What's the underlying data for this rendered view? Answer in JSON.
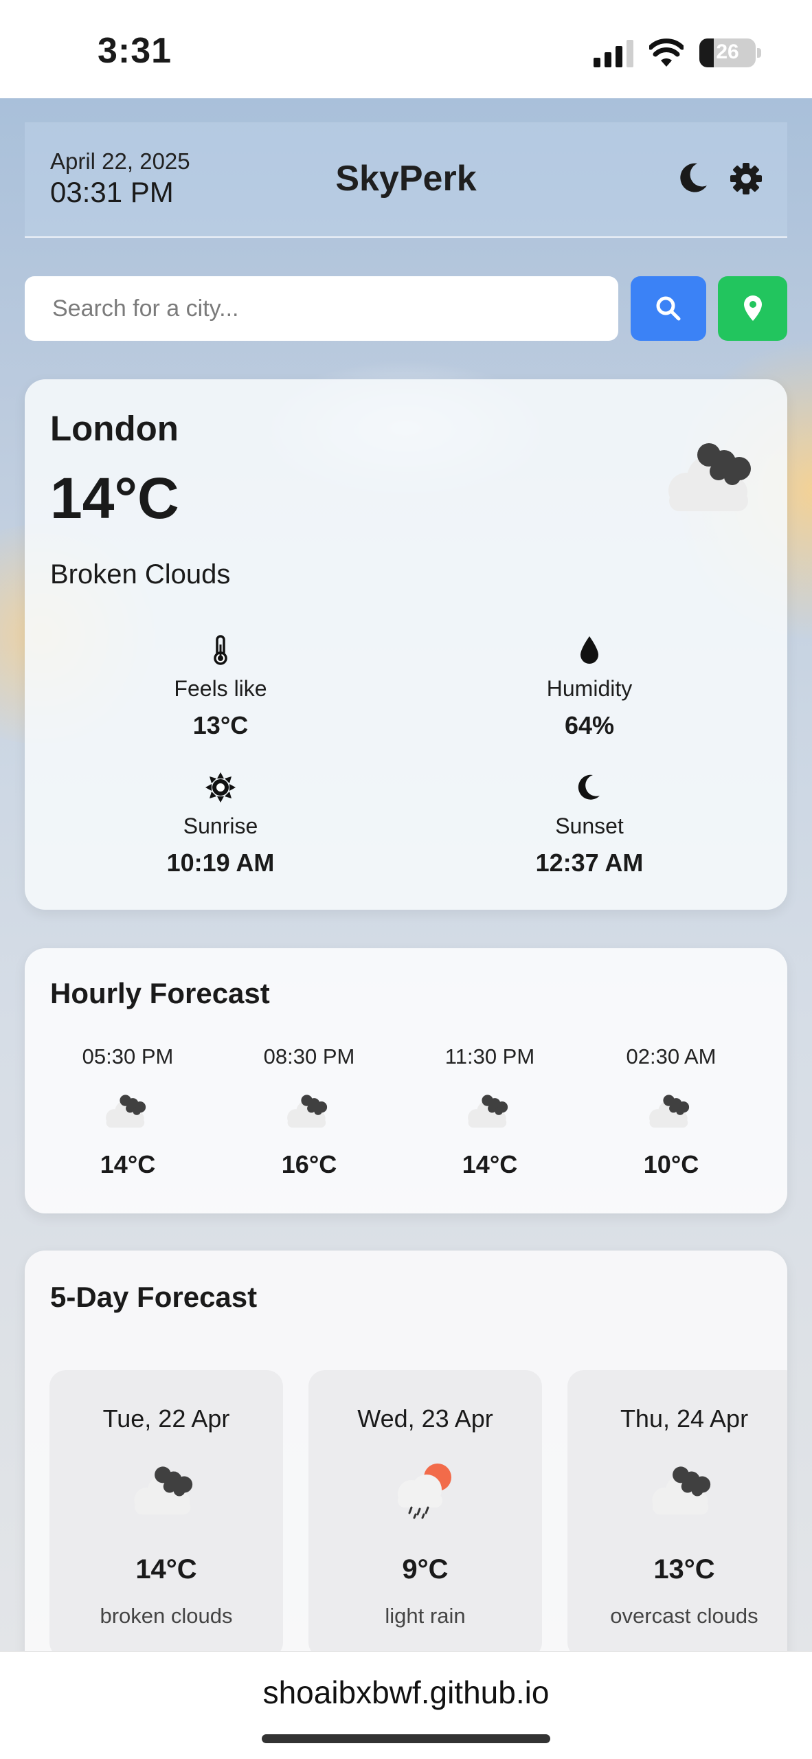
{
  "status_bar": {
    "time": "3:31",
    "battery": "26"
  },
  "header": {
    "date": "April 22, 2025",
    "time": "03:31 PM",
    "title": "SkyPerk",
    "icons": [
      "moon-icon",
      "gear-icon"
    ]
  },
  "search": {
    "placeholder": "Search for a city...",
    "value": "",
    "search_icon": "search-icon",
    "location_icon": "location-pin-icon"
  },
  "current": {
    "city": "London",
    "temp": "14°C",
    "description": "Broken Clouds",
    "icon": "broken-clouds-icon",
    "stats": [
      {
        "icon": "thermometer-icon",
        "label": "Feels like",
        "value": "13°C"
      },
      {
        "icon": "droplet-icon",
        "label": "Humidity",
        "value": "64%"
      },
      {
        "icon": "sun-icon",
        "label": "Sunrise",
        "value": "10:19 AM"
      },
      {
        "icon": "moon-icon",
        "label": "Sunset",
        "value": "12:37 AM"
      }
    ]
  },
  "hourly": {
    "title": "Hourly Forecast",
    "items": [
      {
        "time": "05:30 PM",
        "temp": "14°C",
        "icon": "broken-clouds-icon"
      },
      {
        "time": "08:30 PM",
        "temp": "16°C",
        "icon": "broken-clouds-icon"
      },
      {
        "time": "11:30 PM",
        "temp": "14°C",
        "icon": "broken-clouds-icon"
      },
      {
        "time": "02:30 AM",
        "temp": "10°C",
        "icon": "broken-clouds-icon"
      }
    ]
  },
  "daily": {
    "title": "5-Day Forecast",
    "items": [
      {
        "day": "Tue, 22 Apr",
        "temp": "14°C",
        "summary": "broken clouds",
        "icon": "broken-clouds-icon"
      },
      {
        "day": "Wed, 23 Apr",
        "temp": "9°C",
        "summary": "light rain",
        "icon": "light-rain-icon"
      },
      {
        "day": "Thu, 24 Apr",
        "temp": "13°C",
        "summary": "overcast clouds",
        "icon": "broken-clouds-icon"
      }
    ]
  },
  "browser": {
    "url": "shoaibxbwf.github.io"
  },
  "colors": {
    "search_button": "#3b82f6",
    "location_button": "#22c55e",
    "sun_accent": "#f26b4a"
  }
}
